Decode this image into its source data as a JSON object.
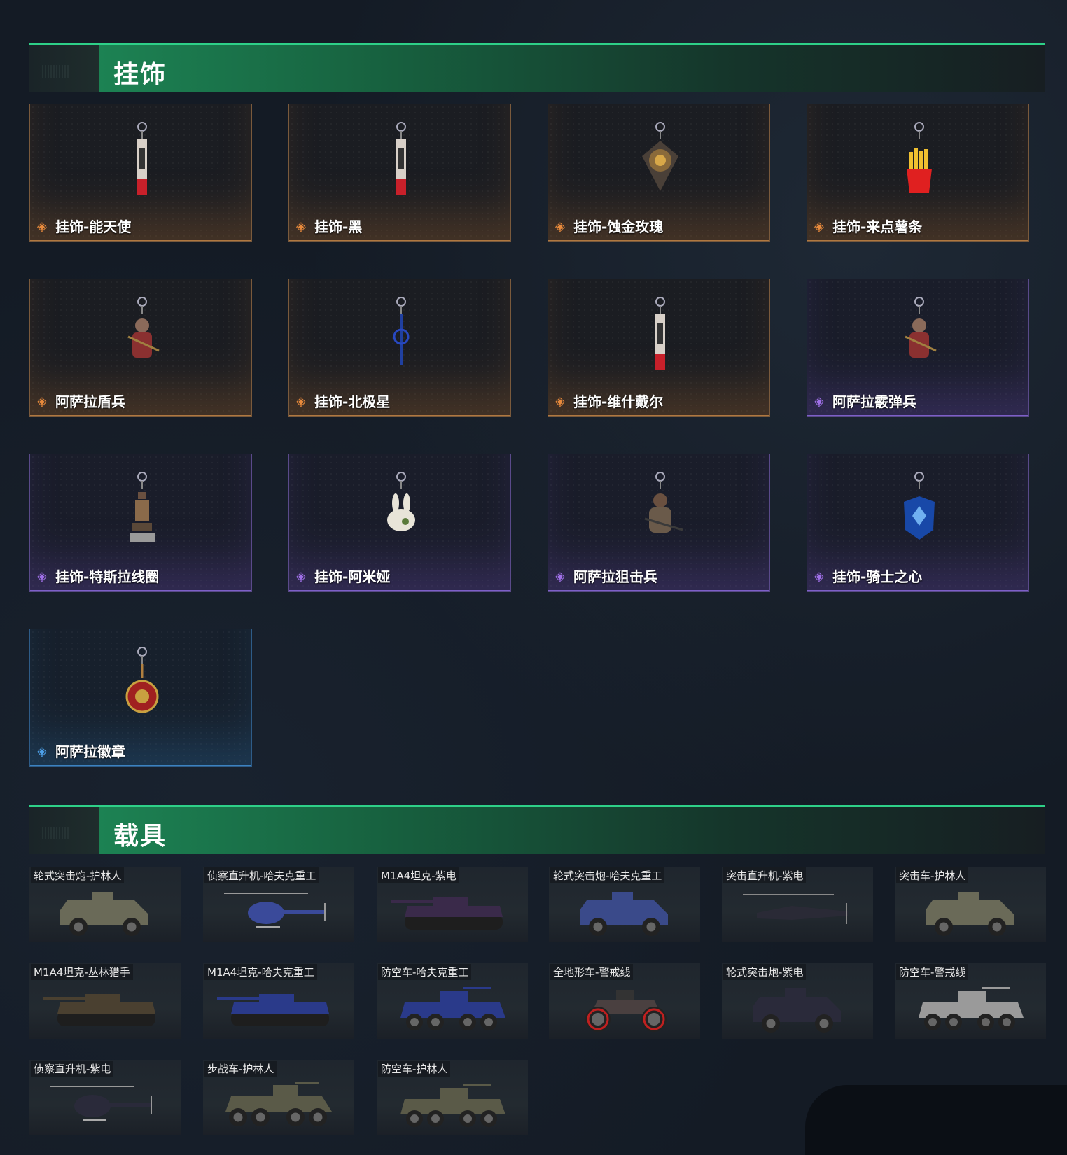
{
  "sections": {
    "charms": {
      "title": "挂饰"
    },
    "vehicles": {
      "title": "载具"
    }
  },
  "charms": [
    {
      "label": "挂饰-能天使",
      "rarity": "gold",
      "icon": "tag-charm-icon"
    },
    {
      "label": "挂饰-黑",
      "rarity": "gold",
      "icon": "tag-charm-icon"
    },
    {
      "label": "挂饰-蚀金玫瑰",
      "rarity": "gold",
      "icon": "rose-medallion-icon"
    },
    {
      "label": "挂饰-来点薯条",
      "rarity": "gold",
      "icon": "fries-icon"
    },
    {
      "label": "阿萨拉盾兵",
      "rarity": "gold",
      "icon": "soldier-figure-icon"
    },
    {
      "label": "挂饰-北极星",
      "rarity": "gold",
      "icon": "blue-keychain-icon"
    },
    {
      "label": "挂饰-维什戴尔",
      "rarity": "gold",
      "icon": "tag-charm-icon"
    },
    {
      "label": "阿萨拉霰弹兵",
      "rarity": "purple",
      "icon": "soldier-figure-icon"
    },
    {
      "label": "挂饰-特斯拉线圈",
      "rarity": "purple",
      "icon": "tesla-coil-icon"
    },
    {
      "label": "挂饰-阿米娅",
      "rarity": "purple",
      "icon": "bunny-icon"
    },
    {
      "label": "阿萨拉狙击兵",
      "rarity": "purple",
      "icon": "sniper-figure-icon"
    },
    {
      "label": "挂饰-骑士之心",
      "rarity": "purple",
      "icon": "shield-icon"
    },
    {
      "label": "阿萨拉徽章",
      "rarity": "blue",
      "icon": "badge-medal-icon"
    }
  ],
  "vehicles": [
    {
      "label": "轮式突击炮-护林人",
      "icon": "armored-car-icon",
      "color": "#6a6a58"
    },
    {
      "label": "侦察直升机-哈夫克重工",
      "icon": "helicopter-icon",
      "color": "#3a4a9a"
    },
    {
      "label": "M1A4坦克-紫电",
      "icon": "tank-icon",
      "color": "#3a2a4a"
    },
    {
      "label": "轮式突击炮-哈夫克重工",
      "icon": "armored-car-icon",
      "color": "#3a4a8a"
    },
    {
      "label": "突击直升机-紫电",
      "icon": "attack-helicopter-icon",
      "color": "#2a2a36"
    },
    {
      "label": "突击车-护林人",
      "icon": "armored-car-icon",
      "color": "#6a6a58"
    },
    {
      "label": "M1A4坦克-丛林猎手",
      "icon": "tank-icon",
      "color": "#4a4030"
    },
    {
      "label": "M1A4坦克-哈夫克重工",
      "icon": "tank-icon",
      "color": "#2a3a8a"
    },
    {
      "label": "防空车-哈夫克重工",
      "icon": "aa-vehicle-icon",
      "color": "#2a3a8a"
    },
    {
      "label": "全地形车-警戒线",
      "icon": "atv-icon",
      "color": "#4a4040"
    },
    {
      "label": "轮式突击炮-紫电",
      "icon": "armored-car-icon",
      "color": "#2a2a3a"
    },
    {
      "label": "防空车-警戒线",
      "icon": "aa-vehicle-icon",
      "color": "#9a9a9a"
    },
    {
      "label": "侦察直升机-紫电",
      "icon": "helicopter-icon",
      "color": "#2a2a3a"
    },
    {
      "label": "步战车-护林人",
      "icon": "ifv-icon",
      "color": "#5a5a48"
    },
    {
      "label": "防空车-护林人",
      "icon": "aa-vehicle-icon",
      "color": "#5a5a48"
    }
  ],
  "colors": {
    "gold": "#e88a3c",
    "purple": "#a070e8",
    "blue": "#4ea0e8",
    "header_green": "#2ed088"
  }
}
